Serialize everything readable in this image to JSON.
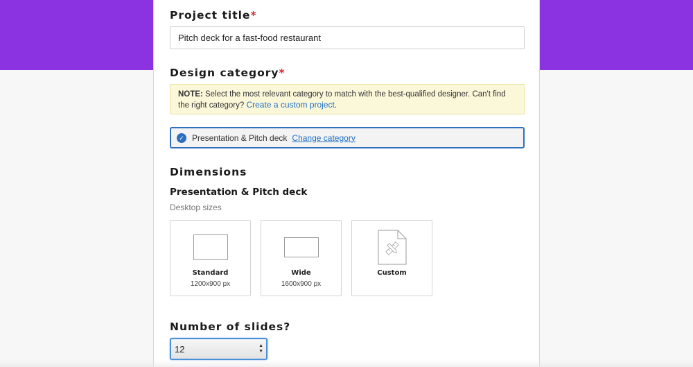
{
  "form": {
    "project_title": {
      "label": "Project title",
      "required_mark": "*",
      "value": "Pitch deck for a fast-food restaurant"
    },
    "design_category": {
      "label": "Design category",
      "required_mark": "*",
      "note_prefix": "NOTE:",
      "note_text": "Select the most relevant category to match with the best-qualified designer. Can't find the right category?",
      "note_link": "Create a custom project",
      "note_suffix": ".",
      "selected": "Presentation & Pitch deck",
      "change_link": "Change category"
    },
    "dimensions": {
      "label": "Dimensions",
      "category_heading": "Presentation & Pitch deck",
      "subheading": "Desktop sizes",
      "options": [
        {
          "name": "Standard",
          "dims": "1200x900 px",
          "icon": "standard-rectangle-icon"
        },
        {
          "name": "Wide",
          "dims": "1600x900 px",
          "icon": "wide-rectangle-icon"
        },
        {
          "name": "Custom",
          "dims": "",
          "icon": "custom-document-icon"
        }
      ]
    },
    "slides": {
      "label": "Number of slides?",
      "value": "12"
    }
  },
  "colors": {
    "brand_purple": "#8b33e0",
    "required_red": "#e0212d",
    "link_blue": "#1f6fc4",
    "selected_border": "#2f6fbf",
    "note_bg": "#fbf7d9"
  }
}
